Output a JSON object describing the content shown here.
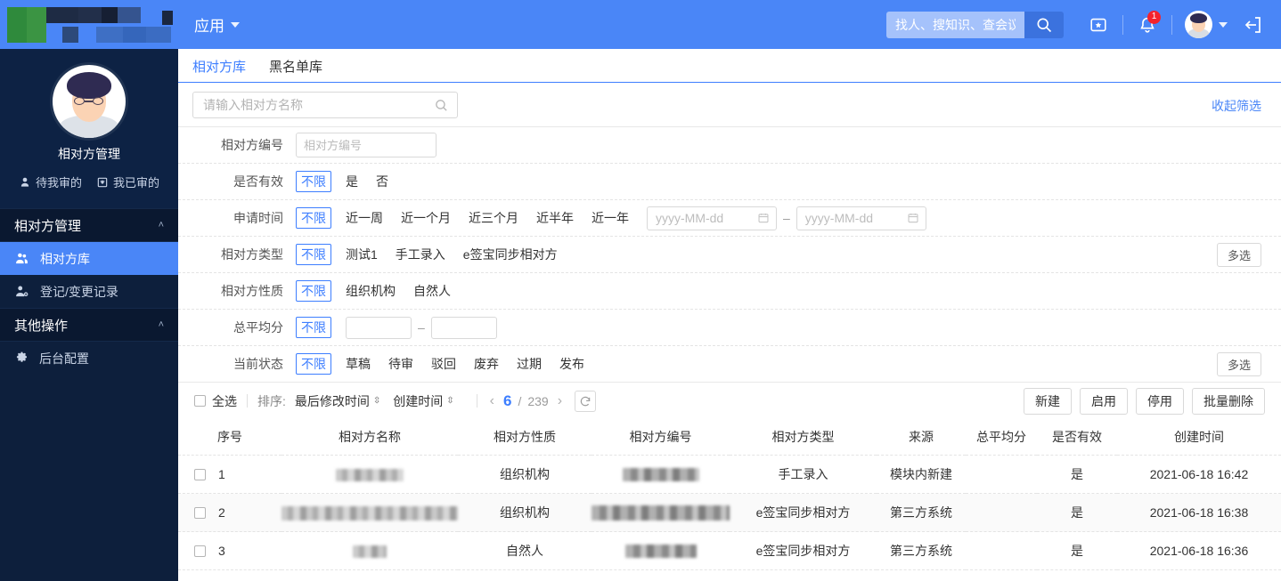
{
  "topbar": {
    "app_menu": "应用",
    "search_placeholder": "找人、搜知识、查会议",
    "search_icon": "search-icon",
    "app_store_icon": "app-store-icon",
    "bell_icon": "bell-icon",
    "notification_count": "1",
    "logout_icon": "logout-icon",
    "accent": "#4a86f7"
  },
  "sidebar": {
    "profile_name": "相对方管理",
    "actions": [
      {
        "label": "待我审的",
        "icon": "person-stamp-icon"
      },
      {
        "label": "我已审的",
        "icon": "archive-box-icon"
      }
    ],
    "groups": [
      {
        "title": "相对方管理",
        "chevron": "˄",
        "items": [
          {
            "label": "相对方库",
            "icon": "counterparty-icon",
            "active": true
          },
          {
            "label": "登记/变更记录",
            "icon": "person-add-icon",
            "active": false
          }
        ]
      },
      {
        "title": "其他操作",
        "chevron": "˄",
        "items": [
          {
            "label": "后台配置",
            "icon": "gear-icon",
            "active": false
          }
        ]
      }
    ],
    "bg": "#0d1f3c",
    "active_bg": "#4a86f7"
  },
  "tabs": [
    {
      "label": "相对方库",
      "active": true
    },
    {
      "label": "黑名单库",
      "active": false
    }
  ],
  "filter": {
    "name_placeholder": "请输入相对方名称",
    "name_value": "",
    "search_icon": "search-icon",
    "collapse_label": "收起筛选",
    "multi_label": "多选",
    "rows": [
      {
        "label": "相对方编号",
        "type": "input",
        "placeholder": "相对方编号",
        "value": ""
      },
      {
        "label": "是否有效",
        "type": "options",
        "options": [
          "不限",
          "是",
          "否"
        ],
        "selected": "不限"
      },
      {
        "label": "申请时间",
        "type": "options-date",
        "options": [
          "不限",
          "近一周",
          "近一个月",
          "近三个月",
          "近半年",
          "近一年"
        ],
        "selected": "不限",
        "date_from_placeholder": "yyyy-MM-dd",
        "date_to_placeholder": "yyyy-MM-dd",
        "date_from_value": "",
        "date_to_value": "",
        "separator": "–"
      },
      {
        "label": "相对方类型",
        "type": "options",
        "options": [
          "不限",
          "测试1",
          "手工录入",
          "e签宝同步相对方"
        ],
        "selected": "不限",
        "has_multi": true
      },
      {
        "label": "相对方性质",
        "type": "options",
        "options": [
          "不限",
          "组织机构",
          "自然人"
        ],
        "selected": "不限"
      },
      {
        "label": "总平均分",
        "type": "options-range",
        "options": [
          "不限"
        ],
        "selected": "不限",
        "min_value": "",
        "max_value": "",
        "separator": "–"
      },
      {
        "label": "当前状态",
        "type": "options",
        "options": [
          "不限",
          "草稿",
          "待审",
          "驳回",
          "废弃",
          "过期",
          "发布"
        ],
        "selected": "不限",
        "has_multi": true
      }
    ]
  },
  "toolbar": {
    "select_all_label": "全选",
    "sort_label": "排序:",
    "sort_options": [
      "最后修改时间",
      "创建时间"
    ],
    "pagination": {
      "prev": "‹",
      "current": "6",
      "divider": "/",
      "total": "239",
      "next": "›",
      "refresh_icon": "refresh-icon"
    },
    "buttons": [
      "新建",
      "启用",
      "停用",
      "批量删除"
    ]
  },
  "table": {
    "columns": [
      "序号",
      "相对方名称",
      "相对方性质",
      "相对方编号",
      "相对方类型",
      "来源",
      "总平均分",
      "是否有效",
      "创建时间"
    ],
    "rows": [
      {
        "index": "1",
        "name": "",
        "name_redacted": true,
        "nature": "组织机构",
        "code": "",
        "code_redacted": true,
        "type": "手工录入",
        "source": "模块内新建",
        "score": "",
        "valid": "是",
        "created": "2021-06-18 16:42"
      },
      {
        "index": "2",
        "name": "",
        "name_redacted": true,
        "nature": "组织机构",
        "code": "",
        "code_redacted": true,
        "type": "e签宝同步相对方",
        "source": "第三方系统",
        "score": "",
        "valid": "是",
        "created": "2021-06-18 16:38"
      },
      {
        "index": "3",
        "name": "",
        "name_redacted": true,
        "nature": "自然人",
        "code": "",
        "code_redacted": true,
        "type": "e签宝同步相对方",
        "source": "第三方系统",
        "score": "",
        "valid": "是",
        "created": "2021-06-18 16:36"
      }
    ]
  }
}
